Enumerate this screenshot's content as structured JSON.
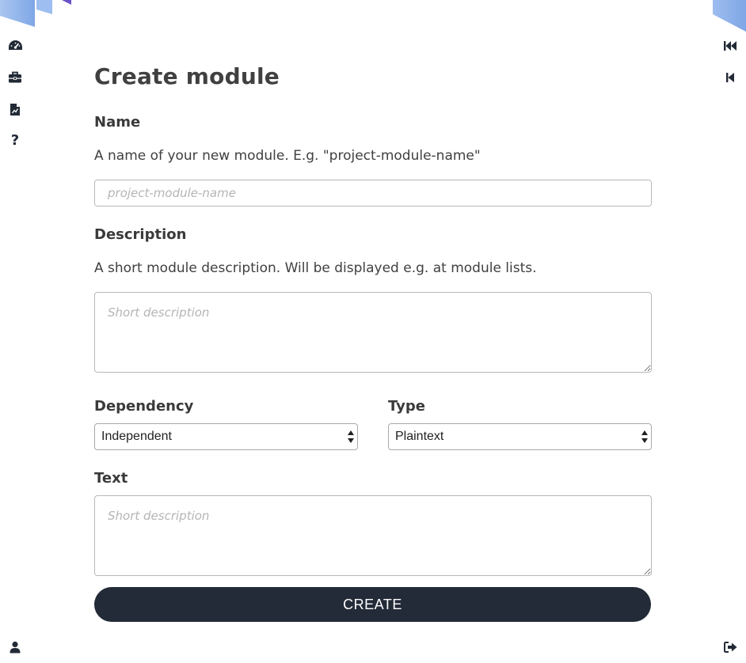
{
  "form": {
    "title": "Create module",
    "name": {
      "label": "Name",
      "help": "A name of your new module. E.g. \"project-module-name\"",
      "placeholder": "project-module-name",
      "value": ""
    },
    "description": {
      "label": "Description",
      "help": "A short module description. Will be displayed e.g. at module lists.",
      "placeholder": "Short description",
      "value": ""
    },
    "dependency": {
      "label": "Dependency",
      "selected": "Independent"
    },
    "type": {
      "label": "Type",
      "selected": "Plaintext"
    },
    "text": {
      "label": "Text",
      "placeholder": "Short description",
      "value": ""
    },
    "create_label": "CREATE"
  },
  "left_rail": {
    "icons": [
      "dashboard-icon",
      "briefcase-icon",
      "document-chart-icon",
      "help-icon",
      "user-icon"
    ],
    "help_glyph": "?"
  },
  "right_rail": {
    "icons": [
      "skip-first-icon",
      "skip-previous-icon",
      "logout-icon"
    ]
  },
  "colors": {
    "primary": "#232b38",
    "corner_blue": "#8fb4ea",
    "corner_purple": "#6a52c8",
    "border": "#b8b8b8"
  }
}
